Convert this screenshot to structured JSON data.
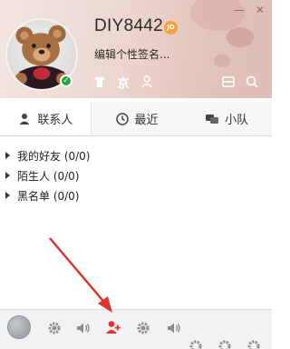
{
  "window": {
    "controls": [
      "minimize-icon",
      "close-icon"
    ]
  },
  "profile": {
    "nickname": "DIY8442",
    "vip_badge": "JD",
    "signature": "编辑个性签名...",
    "status": "online",
    "header_icons_left": [
      "tshirt-icon",
      "jd-icon",
      "person-icon"
    ],
    "jd_text": "京",
    "header_icons_right": [
      "mailbox-icon",
      "search-icon"
    ]
  },
  "tabs": [
    {
      "label": "联系人",
      "icon": "person-icon",
      "active": true
    },
    {
      "label": "最近",
      "icon": "clock-icon",
      "active": false
    },
    {
      "label": "小队",
      "icon": "chat-bubbles-icon",
      "active": false
    }
  ],
  "groups": [
    {
      "label": "我的好友 (0/0)"
    },
    {
      "label": "陌生人 (0/0)"
    },
    {
      "label": "黑名单 (0/0)"
    }
  ],
  "bottom_bar": {
    "icons": [
      "logo-icon",
      "gear-icon",
      "speaker-icon",
      "add-friend-icon",
      "gear-icon",
      "speaker-icon"
    ]
  },
  "colors": {
    "accent_red": "#e0312c",
    "online_green": "#29a33a",
    "vip_orange": "#f2a23a"
  }
}
